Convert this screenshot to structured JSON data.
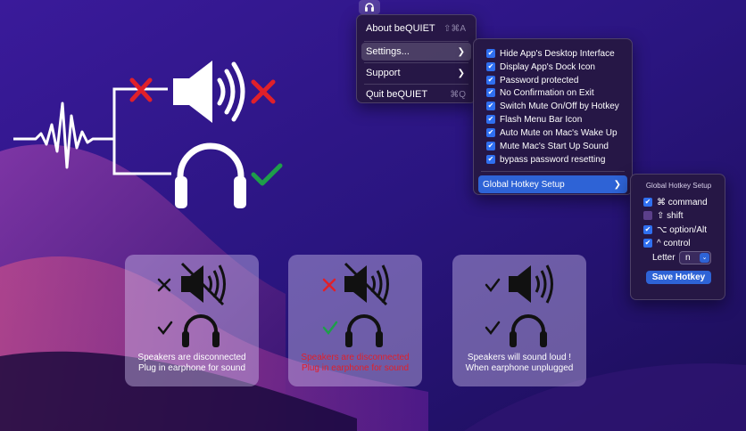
{
  "menubar": {
    "icon": "headphones-icon"
  },
  "app_menu": {
    "items": [
      {
        "label": "About beQUIET",
        "shortcut": "⇧⌘A"
      },
      {
        "label": "Settings...",
        "submenu": true
      },
      {
        "label": "Support",
        "submenu": true
      },
      {
        "label": "Quit beQUIET",
        "shortcut": "⌘Q"
      }
    ]
  },
  "settings_menu": {
    "options": [
      {
        "label": "Hide App's Desktop Interface",
        "checked": true
      },
      {
        "label": "Display App's Dock Icon",
        "checked": true
      },
      {
        "label": "Password protected",
        "checked": true
      },
      {
        "label": "No Confirmation on Exit",
        "checked": true
      },
      {
        "label": "Switch Mute On/Off by Hotkey",
        "checked": true
      },
      {
        "label": "Flash Menu Bar Icon",
        "checked": true
      },
      {
        "label": "Auto Mute on Mac's Wake Up",
        "checked": true
      },
      {
        "label": "Mute Mac's Start Up Sound",
        "checked": true
      },
      {
        "label": "bypass password resetting",
        "checked": true
      }
    ],
    "hotkey_item": "Global Hotkey Setup"
  },
  "hotkey_menu": {
    "title": "Global Hotkey Setup",
    "modifiers": [
      {
        "label": "⌘ command",
        "checked": true
      },
      {
        "label": "⇧ shift",
        "checked": false
      },
      {
        "label": "⌥ option/Alt",
        "checked": true
      },
      {
        "label": "^ control",
        "checked": true
      }
    ],
    "letter_label": "Letter",
    "letter_value": "n",
    "save_label": "Save Hotkey"
  },
  "cards": [
    {
      "line1": "Speakers are disconnected",
      "line2": "Plug in earphone for sound",
      "speaker_status": "cross",
      "headphone_status": "check",
      "speaker_muted": true,
      "caption_color": "#ffffff"
    },
    {
      "line1": "Speakers are disconnected",
      "line2": "Plug in earphone for sound",
      "speaker_status": "cross",
      "headphone_status": "check",
      "speaker_muted": true,
      "caption_color": "#e0202a"
    },
    {
      "line1": "Speakers will sound loud !",
      "line2": "When earphone unplugged",
      "speaker_status": "check",
      "headphone_status": "check",
      "speaker_muted": false,
      "caption_color": "#ffffff"
    }
  ],
  "colors": {
    "accent": "#2e63d6",
    "cross_red": "#e0202a",
    "check_green": "#1e9e4a"
  }
}
